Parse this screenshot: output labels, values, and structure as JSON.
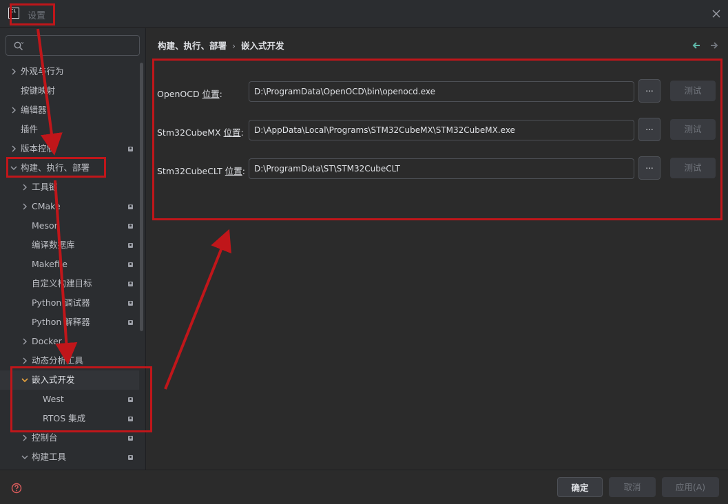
{
  "window": {
    "title": "设置",
    "logo_text": "CL"
  },
  "sidebar": {
    "search_placeholder": "",
    "items": [
      {
        "label": "外观与行为"
      },
      {
        "label": "按键映射"
      },
      {
        "label": "编辑器"
      },
      {
        "label": "插件"
      },
      {
        "label": "版本控制"
      },
      {
        "label": "构建、执行、部署"
      },
      {
        "label": "工具链"
      },
      {
        "label": "CMake"
      },
      {
        "label": "Meson"
      },
      {
        "label": "编译数据库"
      },
      {
        "label": "Makefile"
      },
      {
        "label": "自定义构建目标"
      },
      {
        "label": "Python 调试器"
      },
      {
        "label": "Python 解释器"
      },
      {
        "label": "Docker"
      },
      {
        "label": "动态分析工具"
      },
      {
        "label": "嵌入式开发"
      },
      {
        "label": "West"
      },
      {
        "label": "RTOS 集成"
      },
      {
        "label": "控制台"
      },
      {
        "label": "构建工具"
      }
    ]
  },
  "breadcrumb": {
    "parent": "构建、执行、部署",
    "separator": "›",
    "current": "嵌入式开发"
  },
  "settings": {
    "rows": [
      {
        "label_prefix": "OpenOCD ",
        "label_underlined": "位置",
        "label_suffix": ":",
        "value": "D:\\ProgramData\\OpenOCD\\bin\\openocd.exe",
        "browse_label": "...",
        "test_label": "测试"
      },
      {
        "label_prefix": "Stm32CubeMX ",
        "label_underlined": "位置",
        "label_suffix": ":",
        "value": "D:\\AppData\\Local\\Programs\\STM32CubeMX\\STM32CubeMX.exe",
        "browse_label": "...",
        "test_label": "测试"
      },
      {
        "label_prefix": "Stm32CubeCLT ",
        "label_underlined": "位置",
        "label_suffix": ":",
        "value": "D:\\ProgramData\\ST\\STM32CubeCLT",
        "browse_label": "...",
        "test_label": "测试"
      }
    ]
  },
  "footer": {
    "ok_label": "确定",
    "cancel_label": "取消",
    "apply_label": "应用(A)"
  },
  "colors": {
    "accent": "#2e436e",
    "annotation_red": "#c0161a",
    "nav_arrow": "#5fb8a9",
    "chevron_selected": "#e8a33d",
    "help_icon": "#db5c5c"
  },
  "icons": [
    "search-icon",
    "close-icon",
    "chevron-right-icon",
    "chevron-down-icon",
    "locked-icon",
    "back-arrow-icon",
    "forward-arrow-icon",
    "help-icon"
  ]
}
